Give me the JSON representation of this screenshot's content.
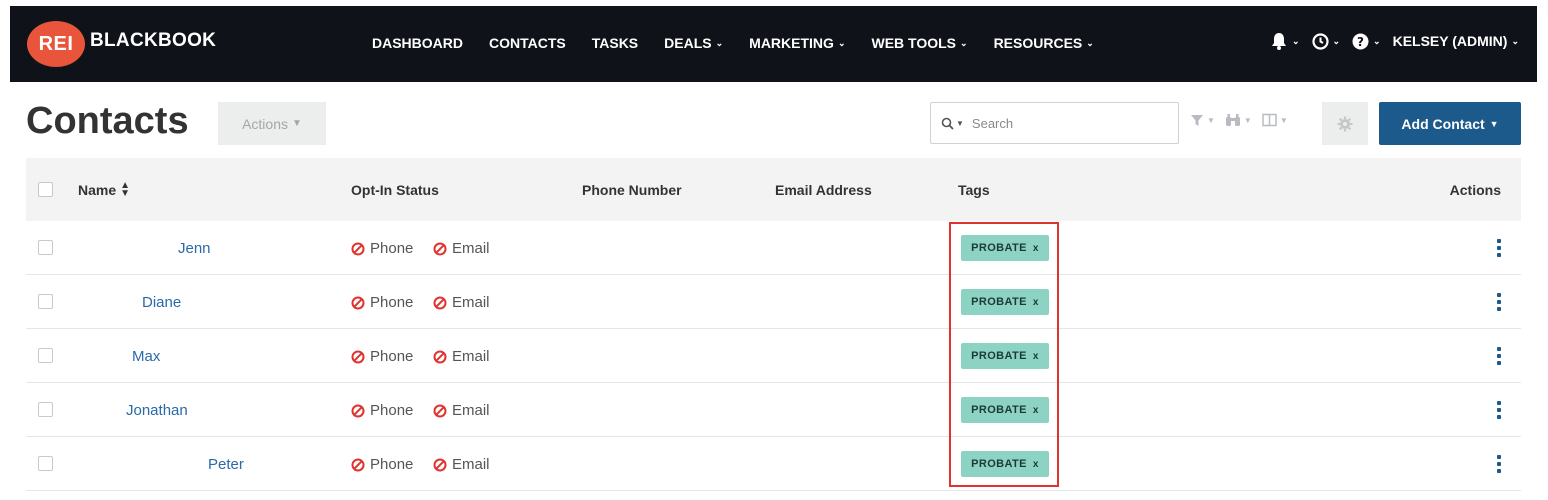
{
  "brand": {
    "badge": "REI",
    "name": "BLACKBOOK",
    "badge_color": "#e8553a"
  },
  "nav": [
    {
      "label": "DASHBOARD",
      "dropdown": false
    },
    {
      "label": "CONTACTS",
      "dropdown": false
    },
    {
      "label": "TASKS",
      "dropdown": false
    },
    {
      "label": "DEALS",
      "dropdown": true
    },
    {
      "label": "MARKETING",
      "dropdown": true
    },
    {
      "label": "WEB TOOLS",
      "dropdown": true
    },
    {
      "label": "RESOURCES",
      "dropdown": true
    }
  ],
  "user": {
    "label": "KELSEY (ADMIN)"
  },
  "page": {
    "title": "Contacts",
    "actions_label": "Actions"
  },
  "search": {
    "placeholder": "Search"
  },
  "add_contact": {
    "label": "Add Contact"
  },
  "columns": {
    "name": "Name",
    "optin": "Opt-In Status",
    "phone": "Phone Number",
    "email": "Email Address",
    "tags": "Tags",
    "actions": "Actions"
  },
  "optin_labels": {
    "phone": "Phone",
    "email": "Email"
  },
  "contacts": [
    {
      "name": "Jenn",
      "tag": "PROBATE"
    },
    {
      "name": "Diane",
      "tag": "PROBATE"
    },
    {
      "name": "Max",
      "tag": "PROBATE"
    },
    {
      "name": "Jonathan",
      "tag": "PROBATE"
    },
    {
      "name": "Peter",
      "tag": "PROBATE"
    }
  ],
  "tag_remove_glyph": "x",
  "colors": {
    "primary": "#1c5a8c",
    "tag_bg": "#8dd3c4",
    "no_icon": "#e0332e",
    "topbar": "#0f1319"
  }
}
